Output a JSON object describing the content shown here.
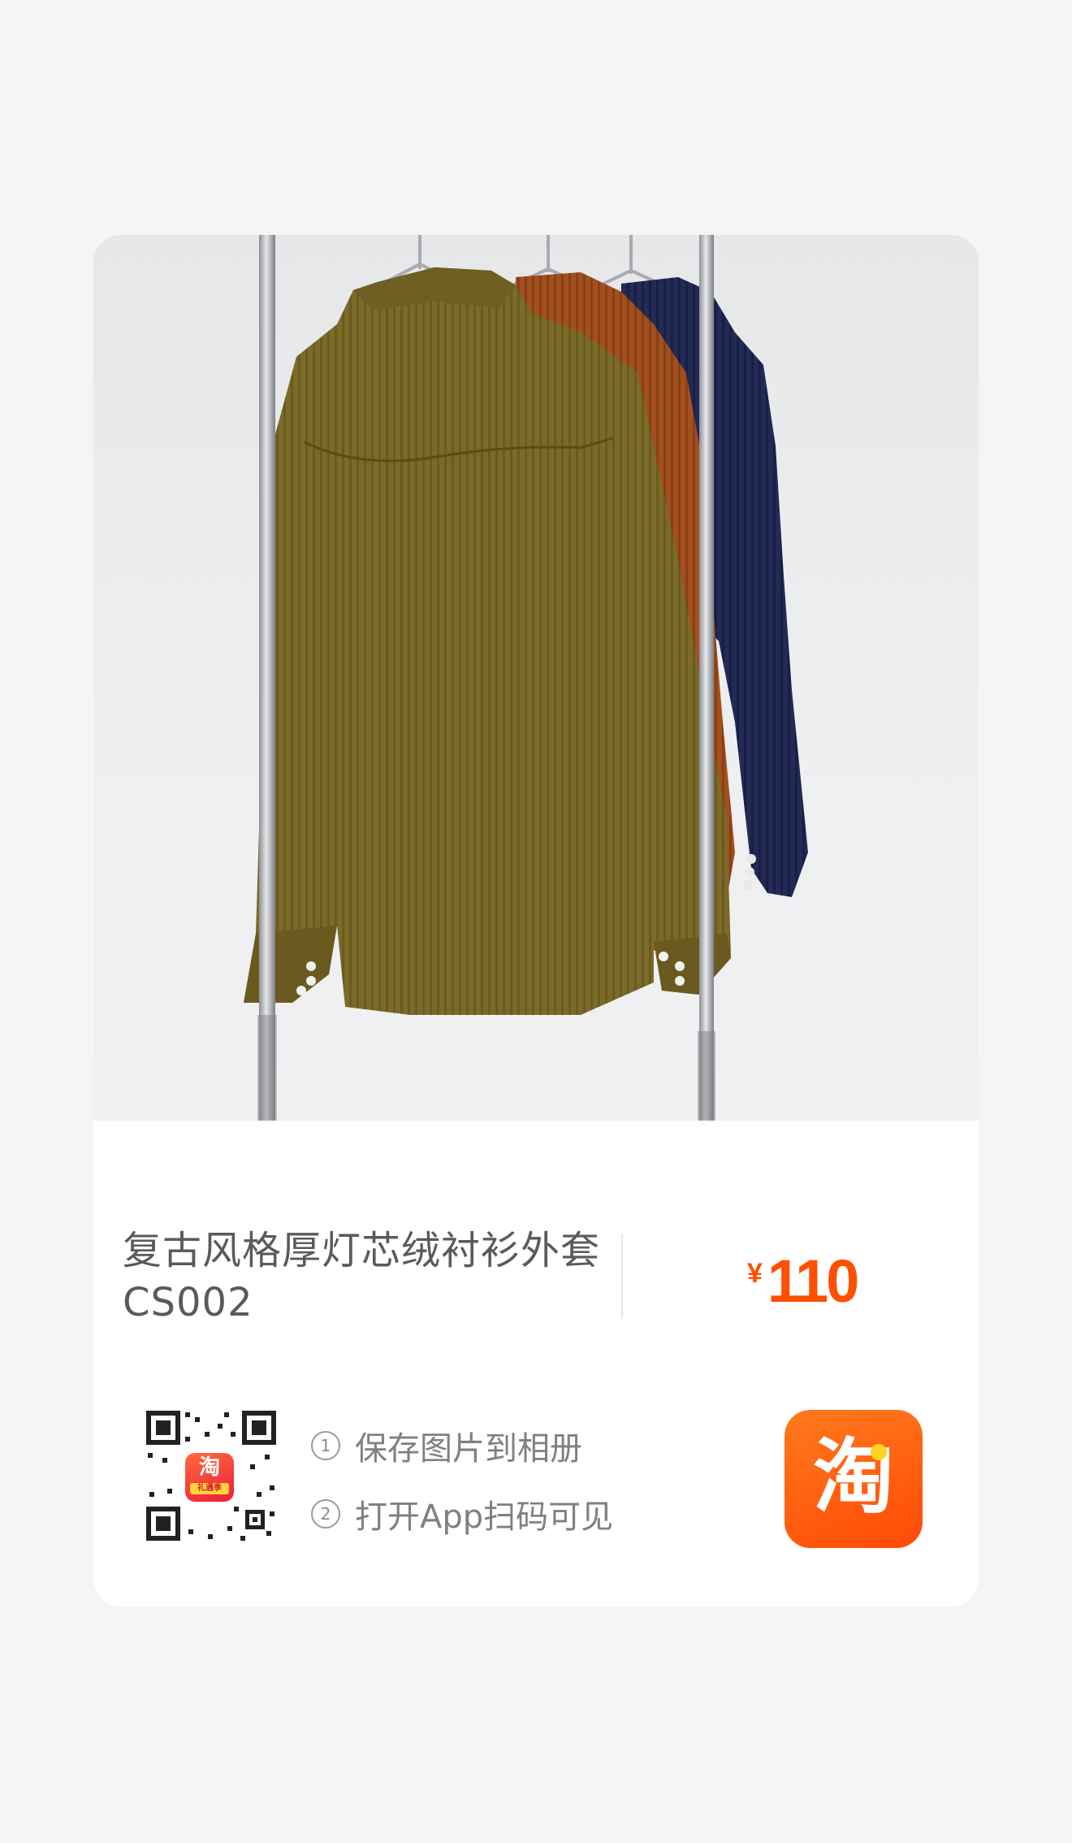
{
  "product": {
    "image_alt": "corduroy shirts on hanger rack",
    "title_line1": "复古风格厚灯芯绒衬衫外套",
    "title_line2": "CS002",
    "price_symbol": "¥",
    "price_value": "110"
  },
  "share": {
    "step1_num": "1",
    "step1_text": "保存图片到相册",
    "step2_num": "2",
    "step2_text": "打开App扫码可见",
    "qr_logo_text": "淘",
    "qr_logo_banner": "礼遇季",
    "app_icon_glyph": "淘"
  },
  "colors": {
    "price": "#ff5000",
    "app_icon": "#ff5a10",
    "background": "#f5f5f5",
    "card": "#ffffff",
    "shirt_olive": "#7a6a28",
    "shirt_rust": "#9e4a1c",
    "shirt_navy": "#1f2750"
  }
}
